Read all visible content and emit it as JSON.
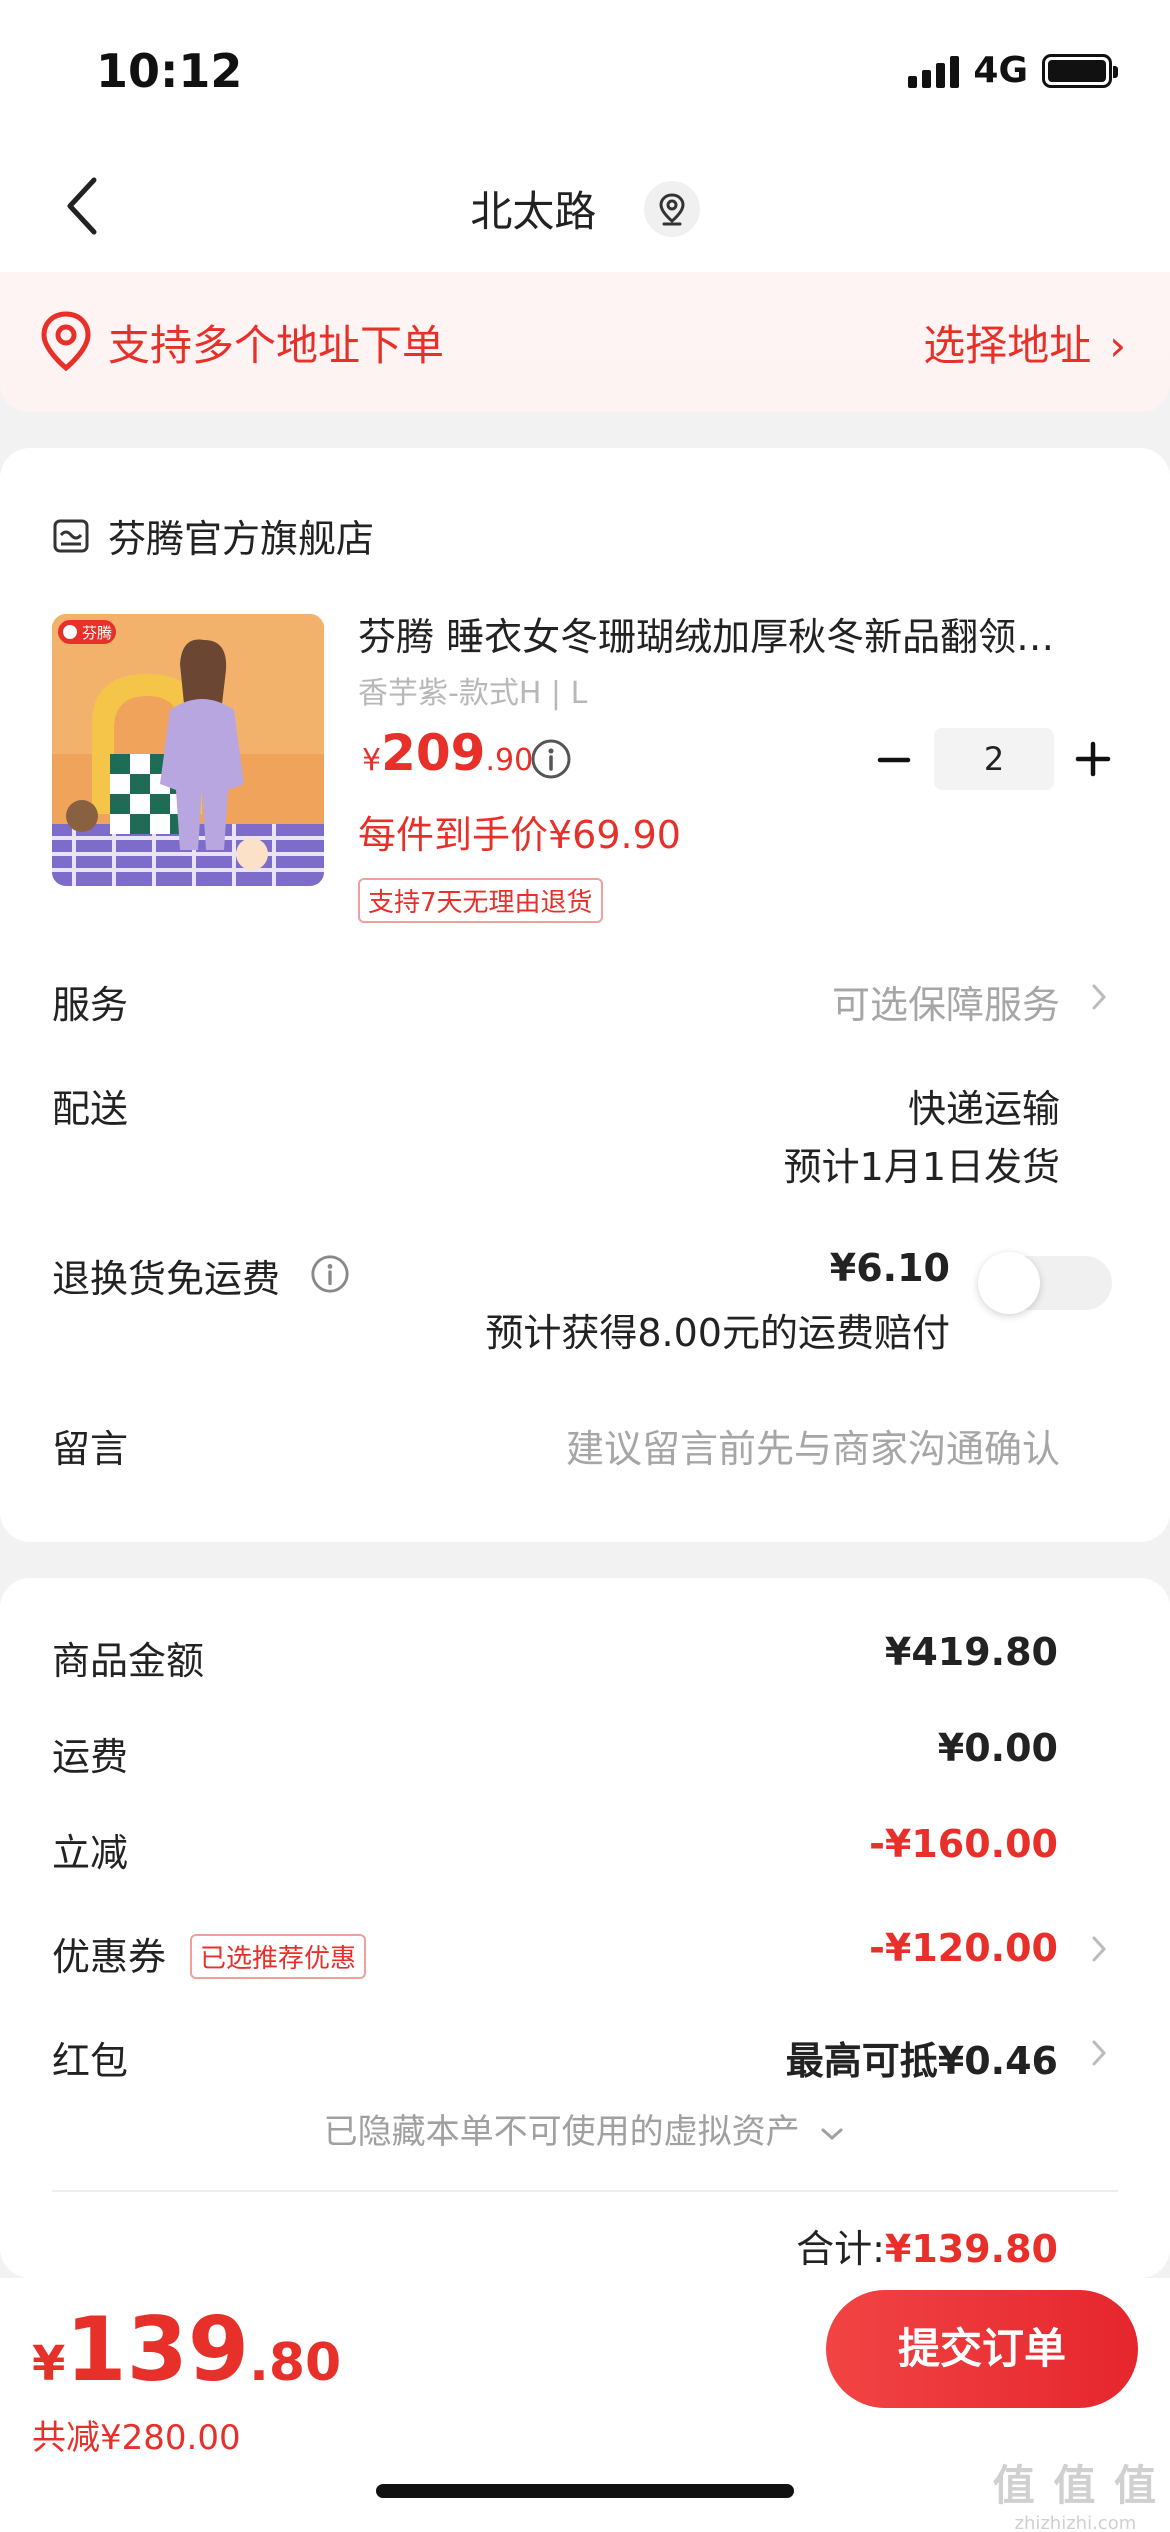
{
  "status_bar": {
    "time": "10:12",
    "network": "4G"
  },
  "nav": {
    "title": "北太路"
  },
  "address_banner": {
    "text": "支持多个地址下单",
    "action": "选择地址"
  },
  "shop": {
    "name": "芬腾官方旗舰店"
  },
  "product": {
    "brand_badge": "芬腾",
    "title": "芬腾 睡衣女冬珊瑚绒加厚秋冬新品翻领…",
    "variant": "香芋紫-款式H | L",
    "price_currency": "¥",
    "price_int": "209",
    "price_dec": ".90",
    "quantity": "2",
    "unit_price": "每件到手价¥69.90",
    "return_tag": "支持7天无理由退货"
  },
  "rows": {
    "service_label": "服务",
    "service_value": "可选保障服务",
    "delivery_label": "配送",
    "delivery_method": "快递运输",
    "delivery_eta": "预计1月1日发货",
    "freight_label": "退换货免运费",
    "freight_price": "¥6.10",
    "freight_note": "预计获得8.00元的运费赔付",
    "message_label": "留言",
    "message_placeholder": "建议留言前先与商家沟通确认"
  },
  "summary": {
    "goods_label": "商品金额",
    "goods_value": "¥419.80",
    "shipping_label": "运费",
    "shipping_value": "¥0.00",
    "discount_label": "立减",
    "discount_value": "-¥160.00",
    "coupon_label": "优惠券",
    "coupon_tag": "已选推荐优惠",
    "coupon_value": "-¥120.00",
    "redpacket_label": "红包",
    "redpacket_value": "最高可抵¥0.46",
    "hidden_assets": "已隐藏本单不可使用的虚拟资产",
    "total_label": "合计:",
    "total_value": "¥139.80"
  },
  "bottom_bar": {
    "currency": "¥",
    "price_int": "139",
    "price_dec": ".80",
    "saved": "共减¥280.00",
    "submit_label": "提交订单"
  },
  "watermark": {
    "line1": "值 值 值",
    "line2": "zhizhizhi.com"
  },
  "colors": {
    "accent": "#e8302a",
    "background": "#f2f2f2",
    "card": "#ffffff"
  }
}
